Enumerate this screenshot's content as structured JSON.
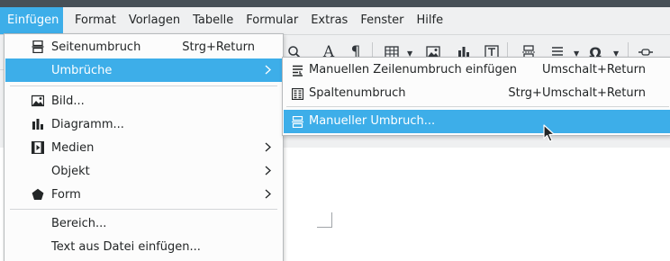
{
  "menubar": {
    "items": [
      {
        "label": "Einfügen",
        "active": true
      },
      {
        "label": "Format"
      },
      {
        "label": "Vorlagen"
      },
      {
        "label": "Tabelle"
      },
      {
        "label": "Formular"
      },
      {
        "label": "Extras"
      },
      {
        "label": "Fenster"
      },
      {
        "label": "Hilfe"
      }
    ]
  },
  "insert_menu": {
    "items": [
      {
        "label": "Seitenumbruch",
        "shortcut": "Strg+Return",
        "icon": "page-break-icon"
      },
      {
        "label": "Umbrüche",
        "submenu": true,
        "highlighted": true
      },
      {
        "label": "Bild...",
        "icon": "image-icon"
      },
      {
        "label": "Diagramm...",
        "icon": "chart-icon"
      },
      {
        "label": "Medien",
        "icon": "media-icon",
        "submenu": true
      },
      {
        "label": "Objekt",
        "submenu": true
      },
      {
        "label": "Form",
        "icon": "shape-icon",
        "submenu": true
      },
      {
        "label": "Bereich..."
      },
      {
        "label": "Text aus Datei einfügen..."
      }
    ]
  },
  "breaks_submenu": {
    "items": [
      {
        "label": "Manuellen Zeilenumbruch einfügen",
        "shortcut": "Umschalt+Return",
        "icon": "line-break-icon"
      },
      {
        "label": "Spaltenumbruch",
        "shortcut": "Strg+Umschalt+Return",
        "icon": "column-break-icon"
      },
      {
        "label": "Manueller Umbruch...",
        "icon": "manual-break-icon",
        "highlighted": true
      }
    ]
  },
  "colors": {
    "accent": "#3daee9",
    "menubar_bg": "#eff0f1",
    "title_strip": "#475057"
  }
}
